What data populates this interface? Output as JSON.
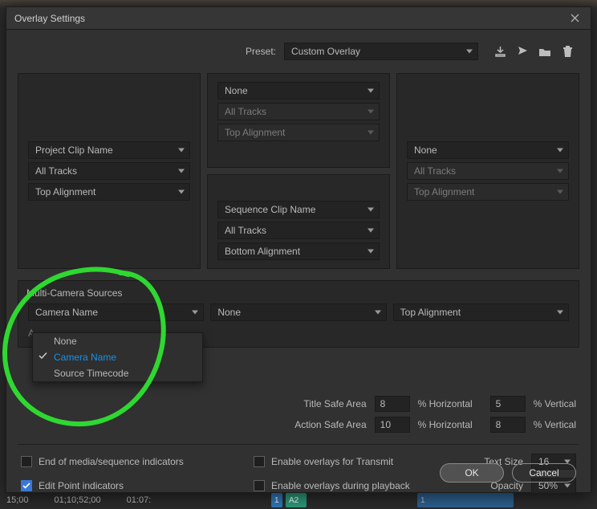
{
  "titlebar": {
    "title": "Overlay Settings"
  },
  "preset": {
    "label": "Preset:",
    "value": "Custom Overlay"
  },
  "panels": {
    "topCenter": {
      "mode": "None",
      "tracks": "All Tracks",
      "align": "Top Alignment"
    },
    "left": {
      "mode": "Project Clip Name",
      "tracks": "All Tracks",
      "align": "Top Alignment"
    },
    "right": {
      "mode": "None",
      "tracks": "All Tracks",
      "align": "Top Alignment"
    },
    "botCenter": {
      "mode": "Sequence Clip Name",
      "tracks": "All Tracks",
      "align": "Bottom Alignment"
    }
  },
  "multiCam": {
    "header": "Multi-Camera Sources",
    "field1": "Camera Name",
    "field2": "None",
    "field3": "Top Alignment",
    "truncated": "A",
    "options": [
      {
        "label": "None",
        "selected": false
      },
      {
        "label": "Camera Name",
        "selected": true
      },
      {
        "label": "Source Timecode",
        "selected": false
      }
    ]
  },
  "safe": {
    "titleLabel": "Title Safe Area",
    "actionLabel": "Action Safe Area",
    "titleH": "8",
    "titleV": "5",
    "actionH": "10",
    "actionV": "8",
    "pctH": "% Horizontal",
    "pctV": "% Vertical"
  },
  "checks": {
    "endMedia": "End of media/sequence indicators",
    "editPoint": "Edit Point indicators",
    "transmit": "Enable overlays for Transmit",
    "playback": "Enable overlays during playback"
  },
  "size": {
    "textLabel": "Text Size",
    "textVal": "16",
    "opLabel": "Opacity",
    "opVal": "50%"
  },
  "footer": {
    "ok": "OK",
    "cancel": "Cancel"
  },
  "backdrop": {
    "a": "15;00",
    "b": "01;10;52;00",
    "c": "01:07:",
    "d": "1",
    "e": "A2",
    "f": "1"
  }
}
